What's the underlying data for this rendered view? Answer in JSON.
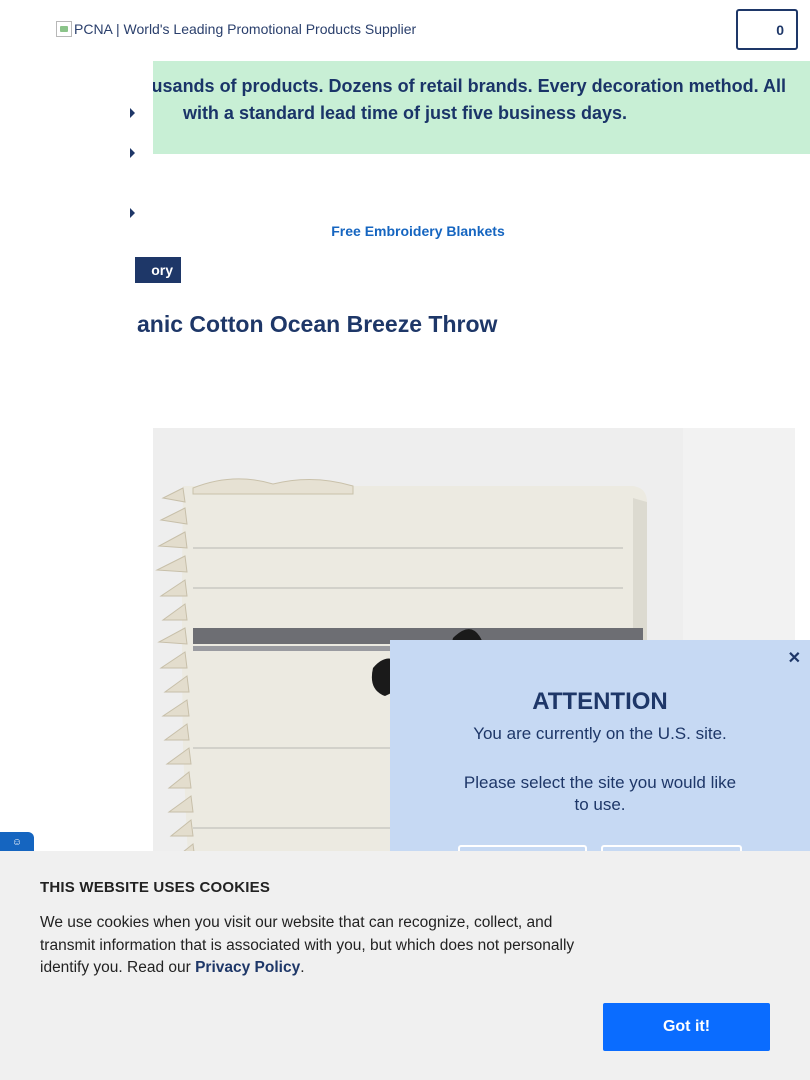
{
  "header": {
    "logo_alt": "PCNA | World's Leading Promotional Products Supplier",
    "cart_count": "0"
  },
  "promo": {
    "line1": "usands of products. Dozens of retail brands. Every decoration method. All",
    "line2": "with a standard lead time of just five business days."
  },
  "links": {
    "free_embroidery": "Free Embroidery Blankets"
  },
  "product": {
    "tag": "ory",
    "title": "anic Cotton Ocean Breeze Throw"
  },
  "attention_modal": {
    "heading": "ATTENTION",
    "line1": "You are currently on the U.S. site.",
    "line2": "Please select the site you would like to use."
  },
  "cookie_banner": {
    "title": "THIS WEBSITE USES COOKIES",
    "body": "We use cookies when you visit our website that can recognize, collect, and transmit information that is associated with you, but which does not personally identify you. Read our ",
    "policy_link": "Privacy Policy",
    "period": ".",
    "button": "Got it!"
  },
  "colors": {
    "navy": "#1e3768",
    "promo_bg": "#c8efd5",
    "modal_bg": "#c6d9f3",
    "cookie_button": "#0a6cff",
    "link": "#1565c0"
  }
}
